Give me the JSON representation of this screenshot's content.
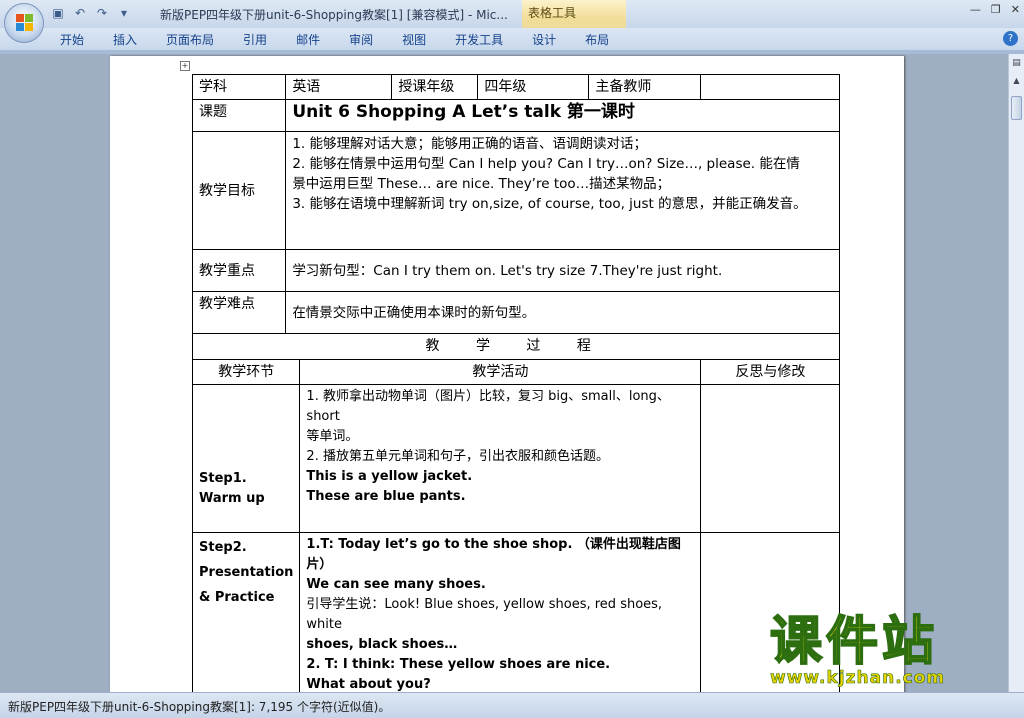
{
  "window": {
    "title": "新版PEP四年级下册unit-6-Shopping教案[1] [兼容模式] - Mic...",
    "context_tab": "表格工具"
  },
  "colors": {
    "title_grad": "#c7d6ea",
    "ribbon_text": "#15428b",
    "watermark_fill": "#f3e400",
    "watermark_stroke": "#2d6f10"
  },
  "ribbon": {
    "tabs": [
      "开始",
      "插入",
      "页面布局",
      "引用",
      "邮件",
      "审阅",
      "视图",
      "开发工具",
      "设计",
      "布局"
    ]
  },
  "table": {
    "row1": {
      "subject_label": "学科",
      "subject": "英语",
      "grade_label": "授课年级",
      "grade": "四年级",
      "teacher_label": "主备教师",
      "teacher": ""
    },
    "topic_label": "课题",
    "topic": "Unit 6 Shopping A Let’s talk  第一课时",
    "goals_label": "教学目标",
    "goals": [
      "1. 能够理解对话大意；能够用正确的语音、语调朗读对话；",
      "2. 能够在情景中运用句型 Can I help you? Can I try…on? Size…, please. 能在情",
      "景中运用巨型 These… are nice. They’re too…描述某物品；",
      "3. 能够在语境中理解新词 try on,size, of course, too, just 的意思，并能正确发音。"
    ],
    "key_label": "教学重点",
    "key": "学习新句型：Can I try them on. Let's try size 7.They're just right.",
    "difficult_label": "教学难点",
    "difficult": "在情景交际中正确使用本课时的新句型。",
    "process_label": "教 学 过 程",
    "headers": [
      "教学环节",
      "教学活动",
      "反思与修改"
    ],
    "step1": {
      "name_lines": [
        "Step1.",
        "Warm up"
      ],
      "activity": [
        "1. 教师拿出动物单词（图片）比较，复习 big、small、long、short",
        "等单词。",
        "2. 播放第五单元单词和句子，引出衣服和颜色话题。",
        "This is a yellow jacket.",
        "These are blue pants."
      ]
    },
    "step2": {
      "name_lines": [
        "Step2.",
        "Presentation",
        "& Practice"
      ],
      "activity": [
        "1.T: Today let’s go to the shoe shop. （课件出现鞋店图片）",
        "We can see many shoes.",
        "引导学生说：Look! Blue shoes, yellow shoes, red shoes, white",
        "shoes, black shoes…",
        "2. T: I think: These yellow shoes are nice.",
        "What about you?"
      ]
    }
  },
  "status": {
    "text": "新版PEP四年级下册unit-6-Shopping教案[1]: 7,195 个字符(近似值)。"
  },
  "watermark": {
    "big": "课件站",
    "url": "www.kjzhan.com"
  }
}
